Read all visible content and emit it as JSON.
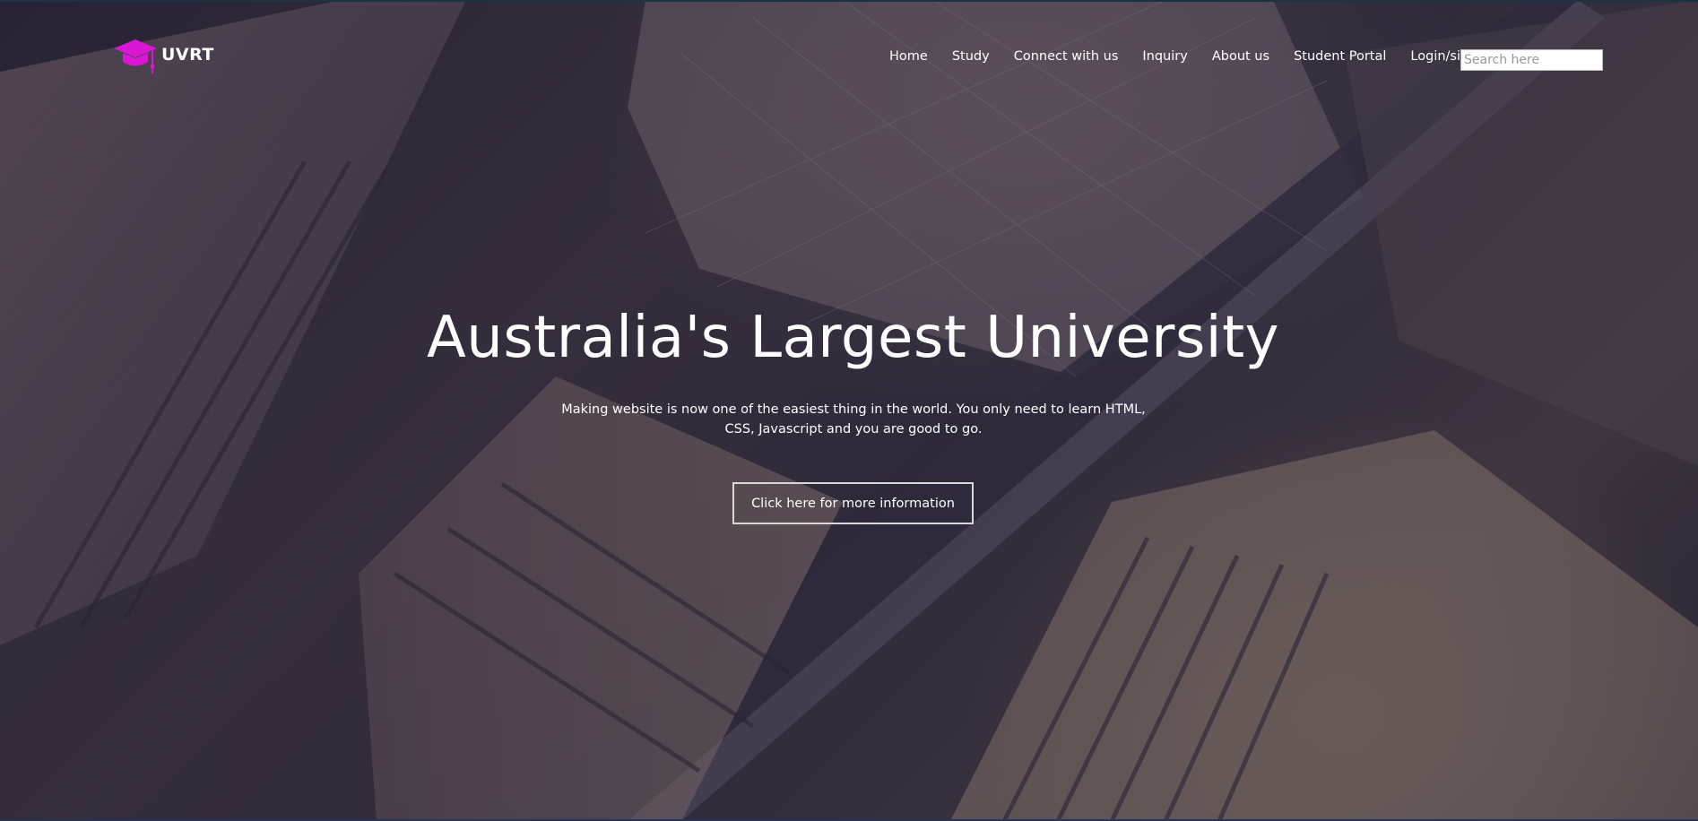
{
  "brand": {
    "name": "UVRT",
    "icon": "graduation-cap-icon",
    "icon_color": "#d916d4"
  },
  "nav": {
    "items": [
      {
        "label": "Home"
      },
      {
        "label": "Study"
      },
      {
        "label": "Connect with us"
      },
      {
        "label": "Inquiry"
      },
      {
        "label": "About us"
      },
      {
        "label": "Student Portal"
      },
      {
        "label": "Login/sign up"
      }
    ],
    "search_placeholder": "Search here"
  },
  "hero": {
    "title": "Australia's Largest University",
    "subtitle": "Making website is now one of the easiest thing in the world. You only need to learn HTML, CSS, Javascript and you are good to go.",
    "cta_label": "Click here for more information"
  }
}
